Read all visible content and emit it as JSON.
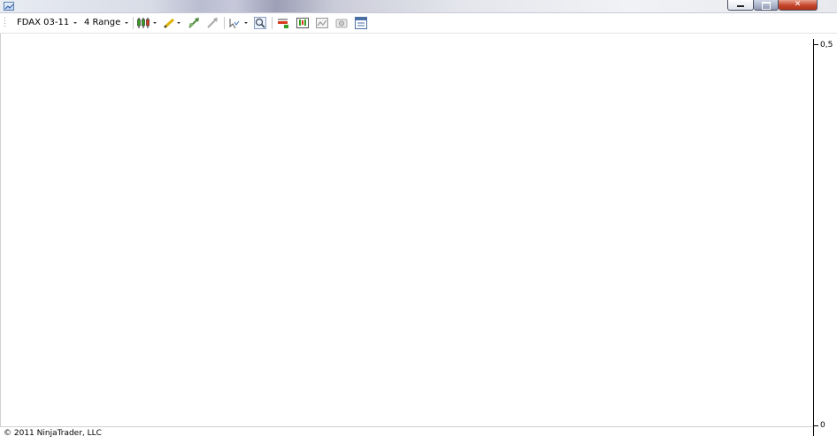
{
  "window": {
    "icon": "chart-app-icon",
    "minimize_icon": "minimize-icon",
    "maximize_icon": "maximize-icon",
    "close_icon": "close-icon",
    "close_color": "#c4452b"
  },
  "toolbar": {
    "instrument": "FDAX 03-11",
    "interval": "4 Range",
    "icons": [
      "bar-type-candlestick-icon",
      "drawing-pencil-icon",
      "zoom-in-arrows-icon",
      "zoom-out-arrows-icon",
      "cursor-select-icon",
      "magnifier-icon",
      "indicators-icon",
      "strategies-icon",
      "image-snapshot-icon",
      "camera-icon",
      "properties-icon"
    ]
  },
  "chart": {
    "y_axis_labels": [
      "0,5",
      "0"
    ]
  },
  "footer": {
    "copyright": "© 2011 NinjaTrader, LLC"
  }
}
